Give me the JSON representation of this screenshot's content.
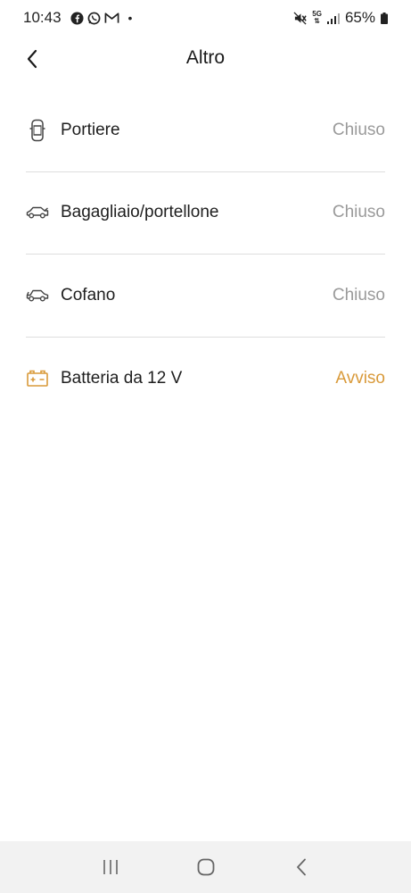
{
  "status_bar": {
    "time": "10:43",
    "battery": "65%",
    "network": "5G",
    "app_icons": [
      "facebook-icon",
      "whatsapp-icon",
      "gmail-icon"
    ],
    "dot": "•"
  },
  "header": {
    "title": "Altro"
  },
  "rows": [
    {
      "label": "Portiere",
      "value": "Chiuso",
      "icon": "car-top-view-icon"
    },
    {
      "label": "Bagagliaio/portellone",
      "value": "Chiuso",
      "icon": "car-trunk-icon"
    },
    {
      "label": "Cofano",
      "value": "Chiuso",
      "icon": "car-hood-icon"
    },
    {
      "label": "Batteria da 12 V",
      "value": "Avviso",
      "icon": "battery-icon"
    }
  ],
  "colors": {
    "warning": "#d99a3a",
    "status_ok": "#9a9a9a"
  }
}
